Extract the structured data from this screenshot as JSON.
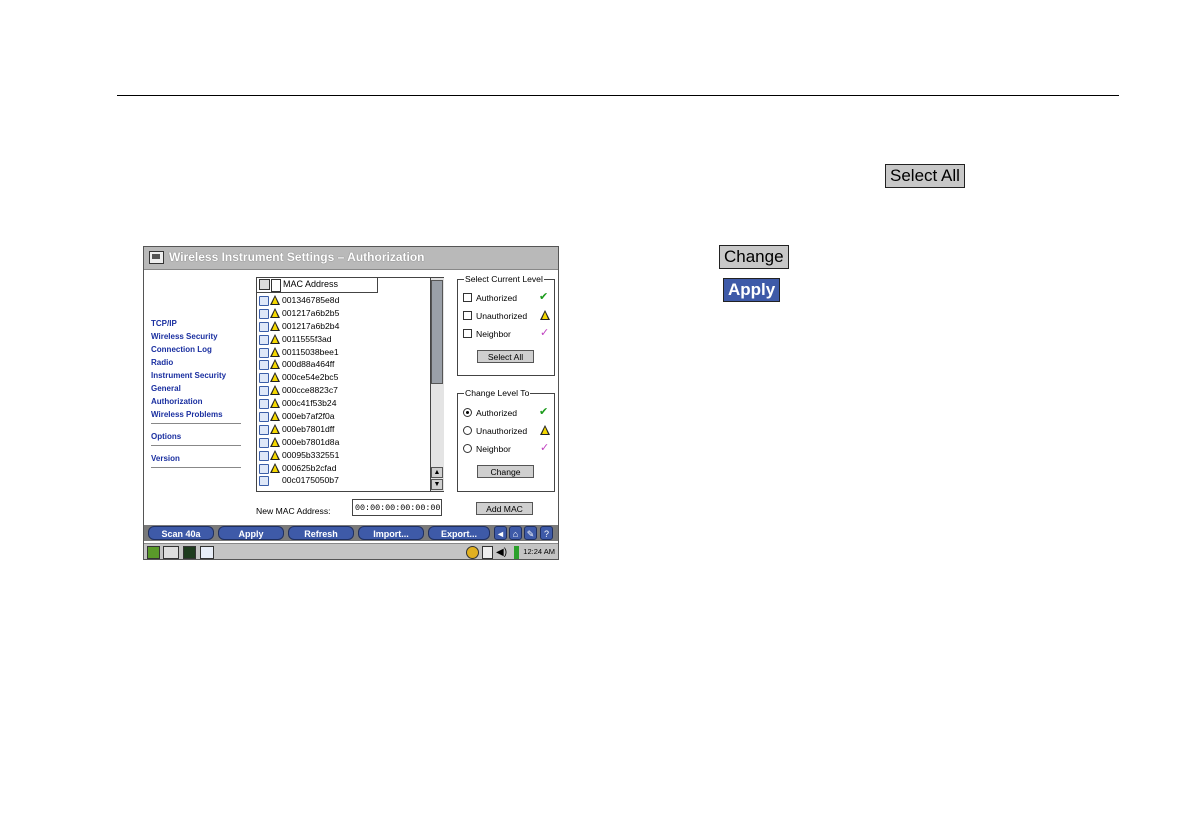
{
  "inline_buttons": {
    "select_all": "Select All",
    "change": "Change",
    "apply": "Apply"
  },
  "window": {
    "title": "Wireless Instrument Settings – Authorization"
  },
  "sidebar": {
    "items": [
      "TCP/IP",
      "Wireless Security",
      "Connection Log",
      "Radio",
      "Instrument Security",
      "General",
      "Authorization",
      "Wireless Problems"
    ],
    "options": "Options",
    "version": "Version"
  },
  "mac_list": {
    "header": "MAC Address",
    "rows": [
      {
        "mac": "001346785e8d",
        "device": "station",
        "warn": true
      },
      {
        "mac": "001217a6b2b5",
        "device": "station",
        "warn": true
      },
      {
        "mac": "001217a6b2b4",
        "device": "station",
        "warn": true
      },
      {
        "mac": "0011555f3ad",
        "device": "station",
        "warn": true
      },
      {
        "mac": "00115038bee1",
        "device": "station",
        "warn": true
      },
      {
        "mac": "000d88a464ff",
        "device": "station",
        "warn": true
      },
      {
        "mac": "000ce54e2bc5",
        "device": "station",
        "warn": true
      },
      {
        "mac": "000cce8823c7",
        "device": "station",
        "warn": true
      },
      {
        "mac": "000c41f53b24",
        "device": "station",
        "warn": true
      },
      {
        "mac": "000eb7af2f0a",
        "device": "station",
        "warn": true
      },
      {
        "mac": "000eb7801dff",
        "device": "station",
        "warn": true
      },
      {
        "mac": "000eb7801d8a",
        "device": "station",
        "warn": true
      },
      {
        "mac": "00095b332551",
        "device": "station",
        "warn": true
      },
      {
        "mac": "000625b2cfad",
        "device": "station",
        "warn": true
      },
      {
        "mac": "00c0175050b7",
        "device": "client",
        "warn": false
      }
    ]
  },
  "current_level": {
    "title": "Select Current Level",
    "options": [
      "Authorized",
      "Unauthorized",
      "Neighbor"
    ],
    "select_all_label": "Select All"
  },
  "change_level": {
    "title": "Change Level To",
    "options": [
      "Authorized",
      "Unauthorized",
      "Neighbor"
    ],
    "selected": "Authorized",
    "change_label": "Change"
  },
  "new_mac": {
    "label": "New MAC Address:",
    "value": "00:00:00:00:00:00",
    "add_label": "Add MAC"
  },
  "toolbar": {
    "buttons": [
      "Scan 40a",
      "Apply",
      "Refresh",
      "Import...",
      "Export..."
    ]
  },
  "status": {
    "time": "12:24 AM"
  },
  "colors": {
    "accent": "#3e5aa8",
    "link": "#1a2fa0",
    "authorized": "#1a9a1a",
    "neighbor": "#c040c0",
    "warning": "#f5d800"
  }
}
